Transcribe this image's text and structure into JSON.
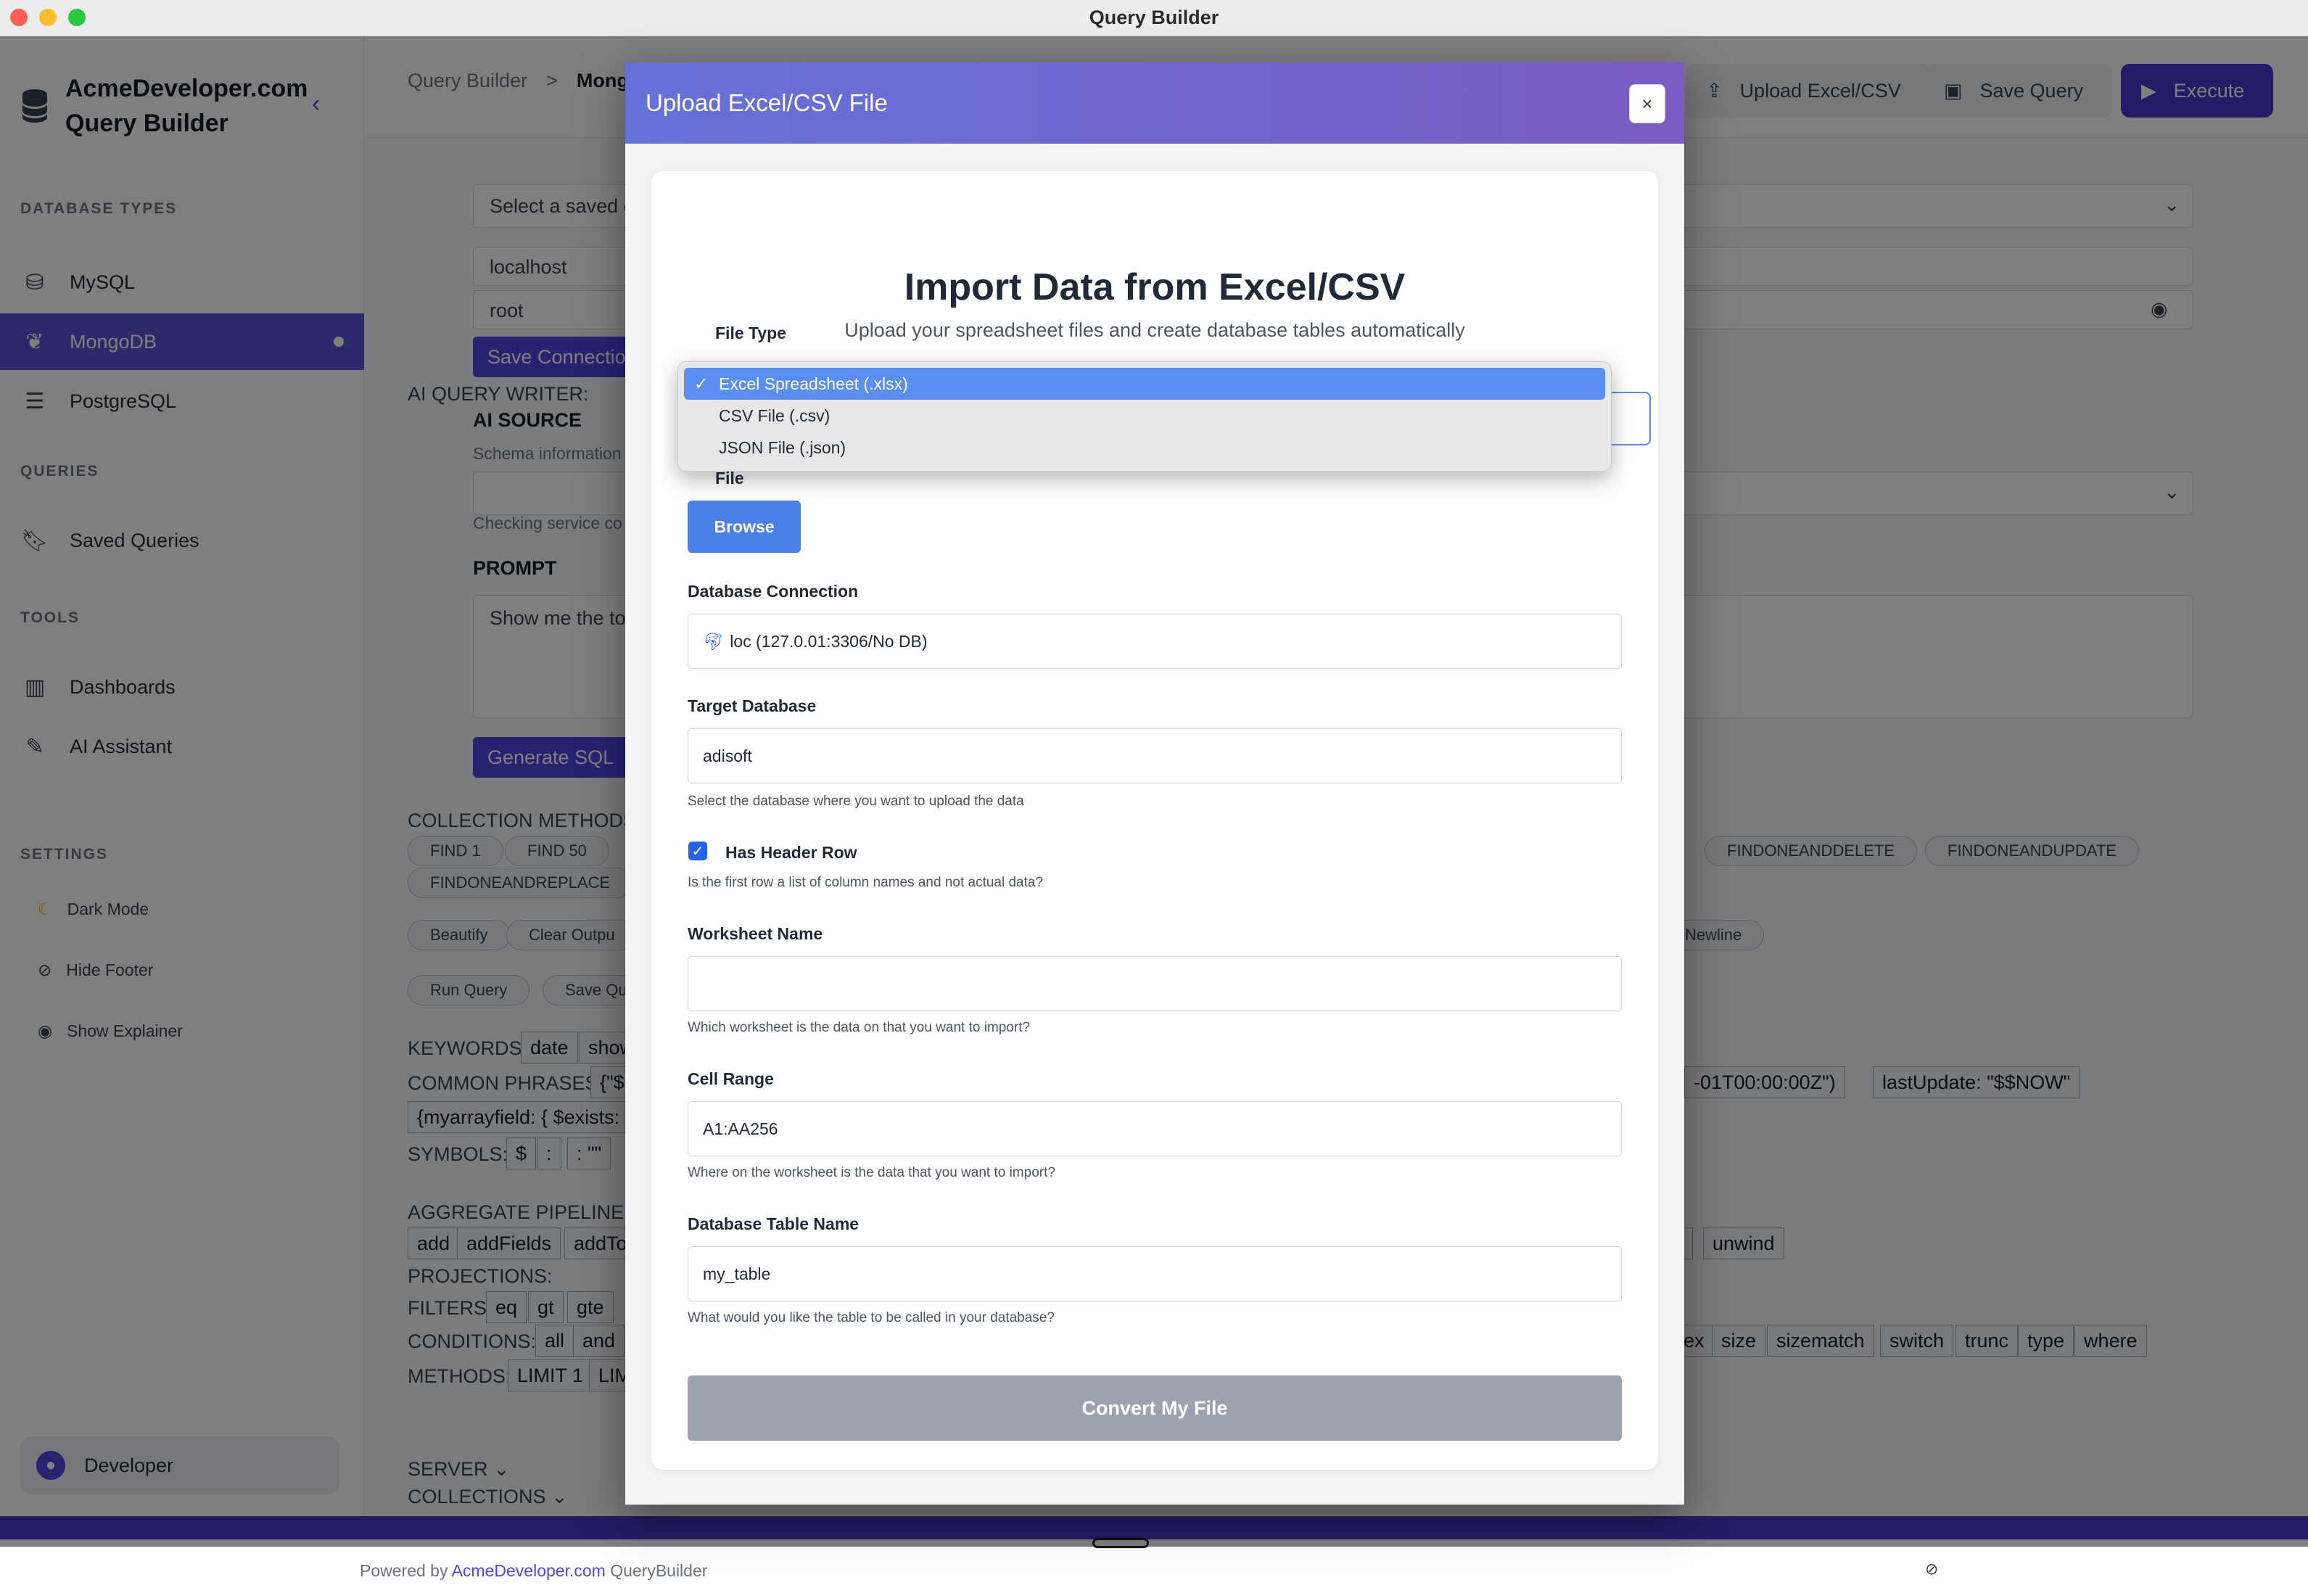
{
  "window": {
    "title": "Query Builder"
  },
  "sidebar": {
    "brand": "AcmeDeveloper.com Query Builder",
    "brand_line1": "AcmeDeveloper.com",
    "brand_line2": "Query Builder",
    "sections": {
      "database_types": "DATABASE TYPES",
      "queries": "QUERIES",
      "tools": "TOOLS",
      "settings": "SETTINGS"
    },
    "database_items": [
      "MySQL",
      "MongoDB",
      "PostgreSQL"
    ],
    "active_item": "MongoDB",
    "query_items": [
      "Saved Queries"
    ],
    "tool_items": [
      "Dashboards",
      "AI Assistant"
    ],
    "setting_items": [
      "Dark Mode",
      "Hide Footer",
      "Show Explainer"
    ],
    "user": "Developer"
  },
  "topbar": {
    "breadcrumb": [
      "Query Builder",
      ">",
      "Mongo"
    ],
    "buttons": {
      "upload": "Upload Excel/CSV",
      "save": "Save Query",
      "execute": "Execute"
    }
  },
  "background": {
    "saved_connection_placeholder": "Select a saved c",
    "host": "localhost",
    "user": "root",
    "save_connection": "Save Connection",
    "ai_query_writer": "AI QUERY WRITER:",
    "ai_source": "AI SOURCE",
    "schema_info": "Schema information",
    "checking_service": "Checking service co",
    "prompt_label": "PROMPT",
    "prompt_text": "Show me the to",
    "generate_sql": "Generate SQL",
    "collection_methods": "COLLECTION METHODS:",
    "method_pills_left": [
      "FIND 1",
      "FIND 50",
      "FINDONEANDREPLACE"
    ],
    "method_pills_right": [
      "FINDONEANDDELETE",
      "FINDONEANDUPDATE"
    ],
    "action_pills": [
      "Beautify",
      "Clear Outpu",
      "Newline"
    ],
    "run_pills": [
      "Run Query",
      "Save Qu"
    ],
    "keywords_label": "KEYWORDS:",
    "keywords": [
      "date",
      "show"
    ],
    "common_phrases_label": "COMMON PHRASES:",
    "common_phrases": [
      "{\"$",
      "-01T00:00:00Z\")",
      "lastUpdate: \"$$NOW\"",
      "{myarrayfield: { $exists:"
    ],
    "symbols_label": "SYMBOLS:",
    "symbols": [
      "$",
      ":",
      ": \"\""
    ],
    "aggregate_label": "AGGREGATE PIPELINE:",
    "aggregate_link": "A",
    "aggregate_chips": [
      "add",
      "addFields",
      "addTo",
      "t",
      "unwind"
    ],
    "projections_label": "PROJECTIONS:",
    "filters_label": "FILTERS:",
    "filters": [
      "eq",
      "gt",
      "gte"
    ],
    "conditions_label": "CONDITIONS:",
    "conditions_left": [
      "all",
      "and"
    ],
    "conditions_right": [
      "ex",
      "size",
      "sizematch",
      "switch",
      "trunc",
      "type",
      "where"
    ],
    "methods_label": "METHODS:",
    "methods": [
      "LIMIT 1",
      "LIM"
    ],
    "server_label": "SERVER",
    "collections_label": "COLLECTIONS"
  },
  "footer": {
    "prefix": "Powered by",
    "link": "AcmeDeveloper.com",
    "suffix": "QueryBuilder"
  },
  "modal": {
    "title": "Upload Excel/CSV File",
    "close": "×",
    "heading": "Import Data from Excel/CSV",
    "subheading": "Upload your spreadsheet files and create database tables automatically",
    "file_type_label": "File Type",
    "file_type_options": [
      "Excel Spreadsheet (.xlsx)",
      "CSV File (.csv)",
      "JSON File (.json)"
    ],
    "file_type_selected": "Excel Spreadsheet (.xlsx)",
    "file_label": "File",
    "browse": "Browse",
    "db_connection_label": "Database Connection",
    "db_connection_value": "loc (127.0.01:3306/No DB)",
    "target_db_label": "Target Database",
    "target_db_value": "adisoft",
    "target_db_help": "Select the database where you want to upload the data",
    "header_row_label": "Has Header Row",
    "header_row_checked": true,
    "header_row_help": "Is the first row a list of column names and not actual data?",
    "worksheet_label": "Worksheet Name",
    "worksheet_value": "",
    "worksheet_help": "Which worksheet is the data on that you want to import?",
    "cell_range_label": "Cell Range",
    "cell_range_value": "A1:AA256",
    "cell_range_help": "Where on the worksheet is the data that you want to import?",
    "table_name_label": "Database Table Name",
    "table_name_value": "my_table",
    "table_name_help": "What would you like the table to be called in your database?",
    "convert": "Convert My File"
  },
  "colors": {
    "accent": "#4f46e5",
    "modal_header_start": "#6672d8",
    "modal_header_end": "#7a5cc4",
    "dropdown_selected": "#5a8ef0",
    "browse": "#4a7fe8",
    "convert_disabled": "#9ca3af"
  }
}
